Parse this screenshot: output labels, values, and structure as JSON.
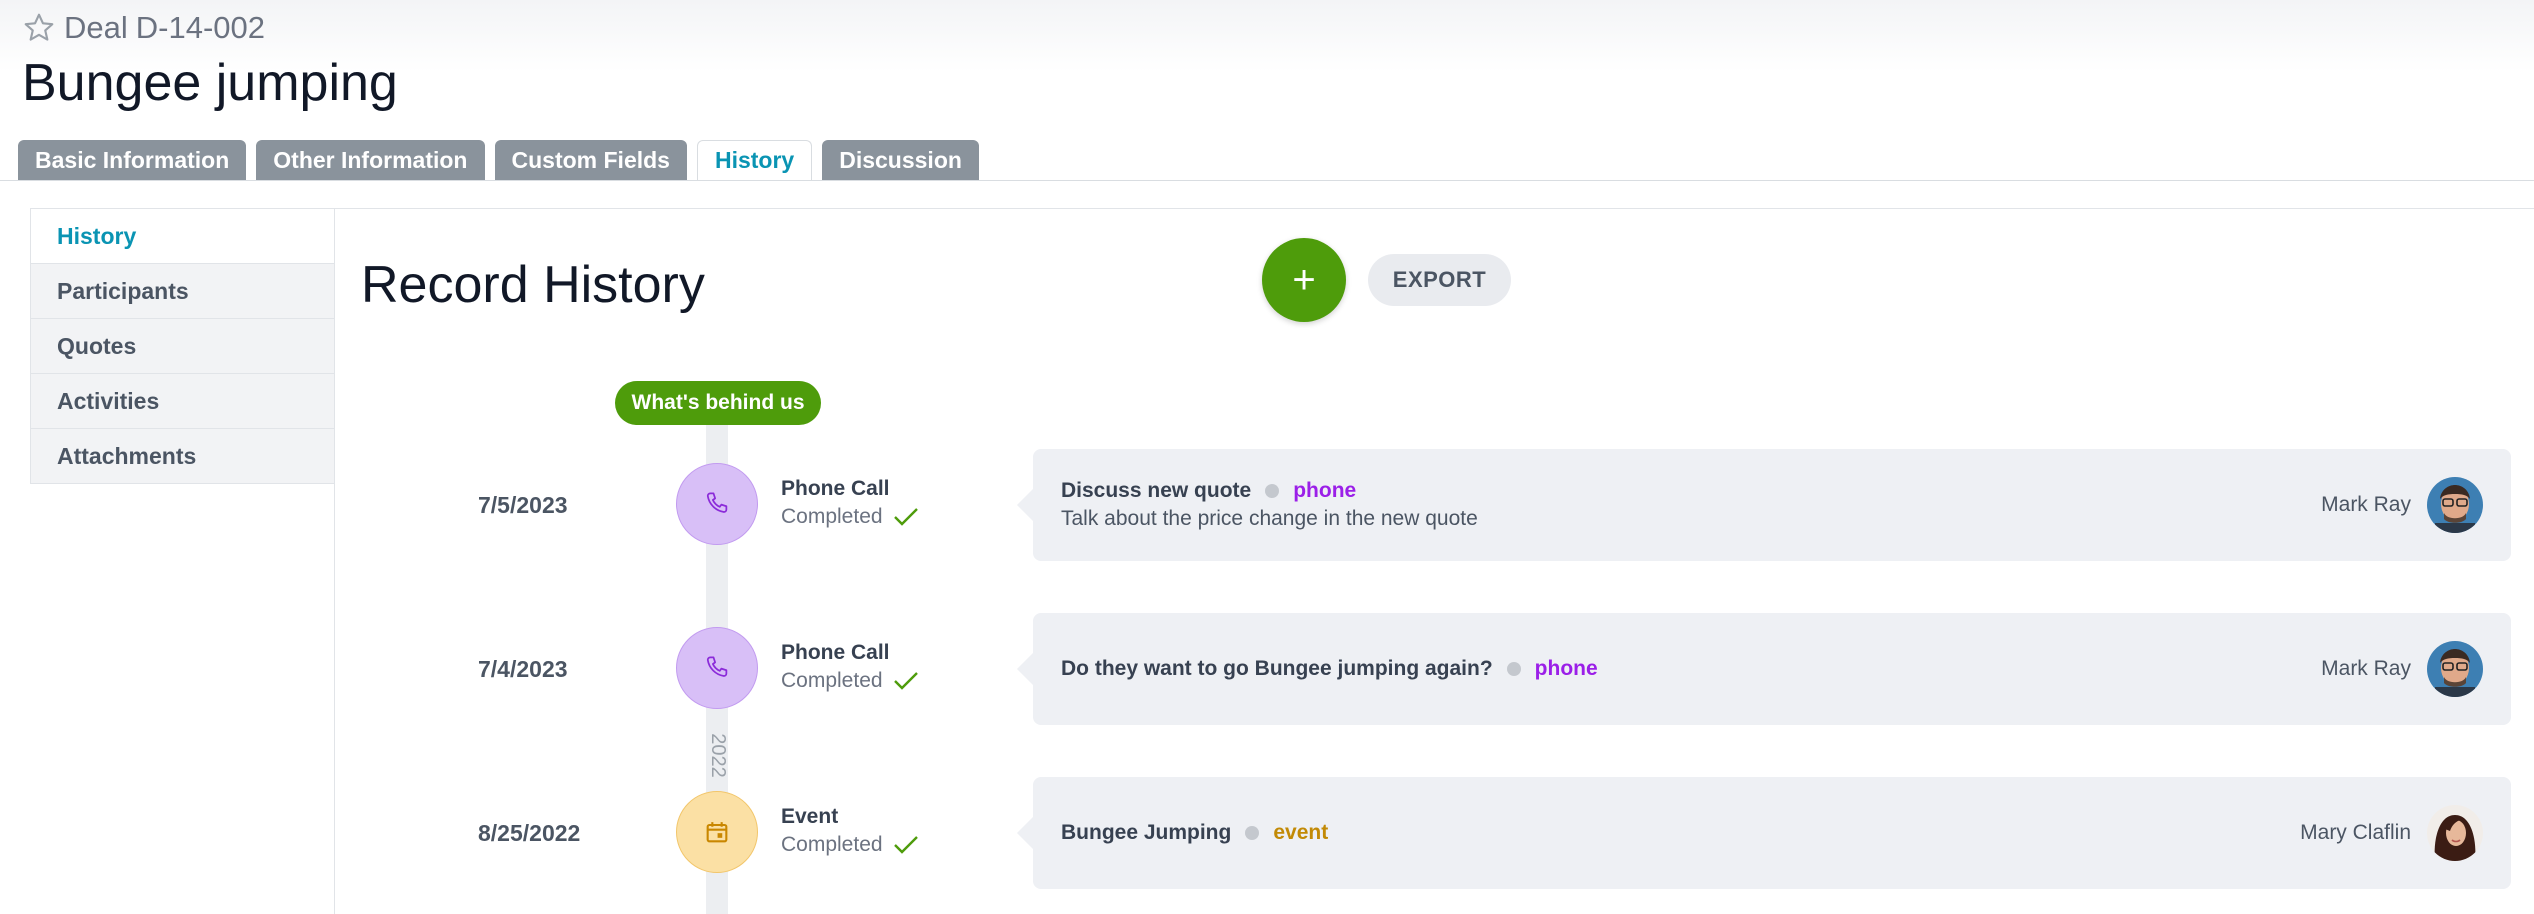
{
  "header": {
    "deal_label": "Deal",
    "deal_id": "D-14-002",
    "title": "Bungee jumping"
  },
  "tabs": [
    {
      "label": "Basic Information",
      "active": false
    },
    {
      "label": "Other Information",
      "active": false
    },
    {
      "label": "Custom Fields",
      "active": false
    },
    {
      "label": "History",
      "active": true
    },
    {
      "label": "Discussion",
      "active": false
    }
  ],
  "sidebar": {
    "items": [
      {
        "label": "History",
        "active": true
      },
      {
        "label": "Participants",
        "active": false
      },
      {
        "label": "Quotes",
        "active": false
      },
      {
        "label": "Activities",
        "active": false
      },
      {
        "label": "Attachments",
        "active": false
      }
    ]
  },
  "history": {
    "title": "Record History",
    "add_label": "+",
    "export_label": "EXPORT",
    "timeline_label": "What's behind us",
    "year_marker": "2022",
    "entries": [
      {
        "date": "7/5/2023",
        "type": "Phone Call",
        "status": "Completed",
        "subject": "Discuss new quote",
        "tag": "phone",
        "description": "Talk about the price change in the new quote",
        "person": "Mark Ray",
        "icon": "phone-icon"
      },
      {
        "date": "7/4/2023",
        "type": "Phone Call",
        "status": "Completed",
        "subject": "Do they want to go Bungee jumping again?",
        "tag": "phone",
        "description": "",
        "person": "Mark Ray",
        "icon": "phone-icon"
      },
      {
        "date": "8/25/2022",
        "type": "Event",
        "status": "Completed",
        "subject": "Bungee Jumping",
        "tag": "event",
        "description": "",
        "person": "Mary Claflin",
        "icon": "calendar-icon"
      }
    ]
  },
  "colors": {
    "accent": "#0a94b3",
    "green": "#4e9c0b",
    "phone_tag": "#9b1fe8",
    "event_tag": "#c28a06",
    "tab_inactive": "#8a939c"
  }
}
